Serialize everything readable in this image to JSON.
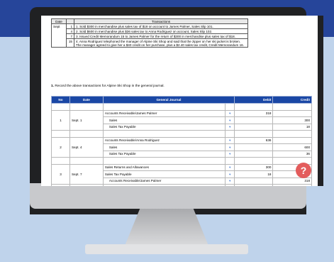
{
  "transactions": {
    "headers": [
      "Date",
      "Transactions"
    ],
    "month": "Sept",
    "rows": [
      {
        "day": "1",
        "text": "1. Sold $300 in merchandise plus sales tax of $18 on account to James Palmer, Sales Slip 101."
      },
      {
        "day": "4",
        "text": "2. Sold $600 in merchandise plus $36 sales tax to Anna Rodriguez on account, Sales Slip 102."
      },
      {
        "day": "7",
        "text": "3. Issued Credit Memorandum 15 to James Palmer for the return of $300 in merchandise plus sales tax of $18."
      },
      {
        "day": "15",
        "text": "4. Anna Rodriguez telephoned the manager of Alpine Ski Shop and said that the zipper on her ski jacket is broken. The manager agreed to give her a $40 credit on her purchase, plus a $2.40 sales tax credit, Credit Memorandum 16."
      }
    ]
  },
  "question": {
    "number": "1.",
    "text": "Record the above transactions for Alpine Ski Shop in the general journal."
  },
  "journal": {
    "headers": {
      "no": "No",
      "date": "Date",
      "account": "General Journal",
      "debit": "Debit",
      "credit": "Credit"
    },
    "entries": [
      {
        "no": "1",
        "date": "Sept. 1",
        "lines": [
          {
            "account": "Accounts Receivable/James Palmer",
            "debit": "318",
            "credit": ""
          },
          {
            "account": "Sales",
            "debit": "",
            "credit": "300"
          },
          {
            "account": "Sales Tax Payable",
            "debit": "",
            "credit": "18"
          }
        ]
      },
      {
        "no": "2",
        "date": "Sept. 4",
        "lines": [
          {
            "account": "Accounts Receivable/Anna Rodriguez",
            "debit": "636",
            "credit": ""
          },
          {
            "account": "Sales",
            "debit": "",
            "credit": "600"
          },
          {
            "account": "Sales Tax Payable",
            "debit": "",
            "credit": "36"
          }
        ]
      },
      {
        "no": "3",
        "date": "Sept. 7",
        "lines": [
          {
            "account": "Sales Returns and Allowances",
            "debit": "300",
            "credit": ""
          },
          {
            "account": "Sales Tax Payable",
            "debit": "18",
            "credit": ""
          },
          {
            "account": "Accounts Receivable/James Palmer",
            "debit": "",
            "credit": "318"
          }
        ]
      }
    ]
  },
  "help": {
    "label": "?",
    "icon": "help-icon",
    "color": "#e35c5c"
  },
  "colors": {
    "header": "#1a47a5",
    "background_top": "#26459a",
    "background": "#bfd3eb"
  }
}
